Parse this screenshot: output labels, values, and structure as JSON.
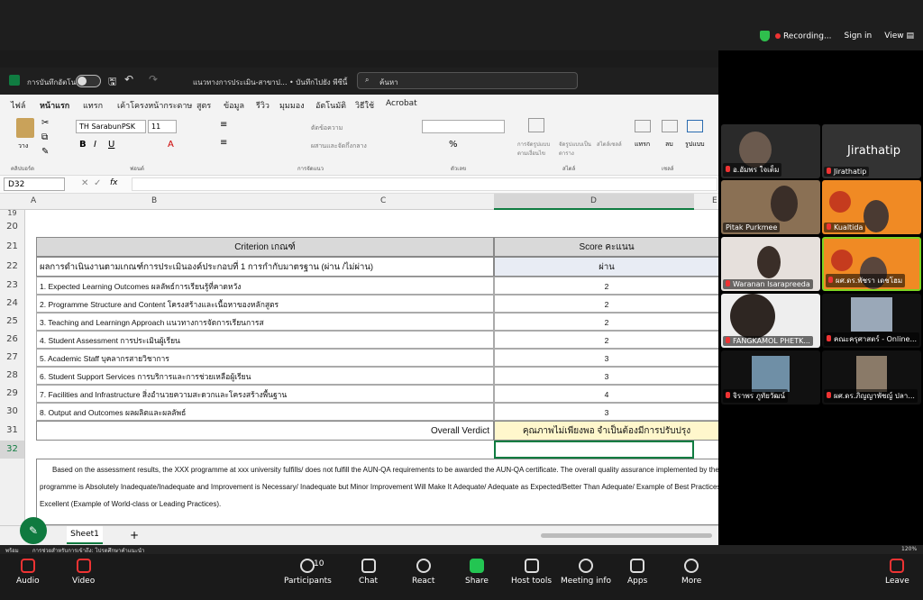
{
  "zoom_top": {
    "recording": "Recording...",
    "sign_in": "Sign in",
    "view": "View"
  },
  "excel": {
    "autosave": "การบันทึกอัตโนมัติ",
    "doc_title": "แนวทางการประเมิน-สาขาป... • บันทึกไปยัง พีซีนี้",
    "search": "ค้นหา",
    "menu": [
      "ไฟล์",
      "หน้าแรก",
      "แทรก",
      "เค้าโครงหน้ากระดาษ",
      "สูตร",
      "ข้อมูล",
      "รีวิว",
      "มุมมอง",
      "อัตโนมัติ",
      "วิธีใช้",
      "Acrobat"
    ],
    "font": "TH SarabunPSK",
    "font_size": "11",
    "groups": [
      "คลิปบอร์ด",
      "ฟอนต์",
      "การจัดแนว",
      "ตัวเลข",
      "สไตล์",
      "เซลล์"
    ],
    "ribbon_labels": {
      "paste": "วาง",
      "wrap": "ตัดข้อความ",
      "merge": "ผสานและจัดกึ่งกลาง",
      "cond_fmt": "การจัดรูปแบบตามเงื่อนไข",
      "fmt_table": "จัดรูปแบบเป็นตาราง",
      "cell_styles": "สไตล์เซลล์",
      "insert": "แทรก",
      "delete": "ลบ",
      "format": "รูปแบบ"
    },
    "namebox": "D32",
    "fx": "fx",
    "columns": [
      "A",
      "B",
      "C",
      "D",
      "E"
    ],
    "rows": [
      "19",
      "20",
      "21",
      "22",
      "23",
      "24",
      "25",
      "26",
      "27",
      "28",
      "29",
      "30",
      "31",
      "32"
    ],
    "table_header": {
      "criterion": "Criterion เกณฑ์",
      "score": "Score คะแนน"
    },
    "row22": {
      "label": "ผลการดำเนินงานตามเกณฑ์การประเมินองค์ประกอบที่ 1 การกำกับมาตรฐาน (ผ่าน /ไม่ผ่าน)",
      "score": "ผ่าน"
    },
    "criteria": [
      {
        "label": "1. Expected Learning Outcomes ผลลัพธ์การเรียนรู้ที่คาดหวัง",
        "score": "2"
      },
      {
        "label": "2. Programme Structure and Content โครงสร้างและเนื้อหาของหลักสูตร",
        "score": "2"
      },
      {
        "label": "3. Teaching and Learningn Approach แนวทางการจัดการเรียนการส",
        "score": "2"
      },
      {
        "label": "4. Student Assessment การประเมินผู้เรียน",
        "score": "2"
      },
      {
        "label": "5. Academic Staff บุคลากรสายวิชาการ",
        "score": "3"
      },
      {
        "label": "6. Student Support Services การบริการและการช่วยเหลือผู้เรียน",
        "score": "3"
      },
      {
        "label": "7. Facilities and Infrastructure สิ่งอำนวยความสะดวกและโครงสร้างพื้นฐาน",
        "score": "4"
      },
      {
        "label": "8. Output and Outcomes ผลผลิตและผลลัพธ์",
        "score": "3"
      }
    ],
    "overall_label": "Overall Verdict",
    "overall_value": "คุณภาพไม่เพียงพอ จำเป็นต้องมีการปรับปรุง",
    "paragraph": "Based on the assessment results, the XXX programme at xxx university fulfills/ does not fulfill the AUN-QA requirements to be awarded the AUN-QA certificate. The overall quality assurance implemented by the programme is Absolutely Inadequate/Inadequate and Improvement is Necessary/ Inadequate but Minor Improvement Will Make It Adequate/ Adequate as Expected/Better Than Adequate/ Example of Best Practices/ Excellent (Example of World-class or Leading Practices).",
    "sheet_tab": "Sheet1",
    "add_sheet": "+",
    "status_left": "พร้อม",
    "status_access": "การช่วยสำหรับการเข้าถึง: โปรดศึกษาคำแนะนำ",
    "zoom_level": "120%"
  },
  "participants": [
    {
      "name": "อ.อัมพร ใจเต็ม"
    },
    {
      "name": "Jirathatip",
      "big": "Jirathatip"
    },
    {
      "name": "Pitak Purkmee"
    },
    {
      "name": "Kualtida"
    },
    {
      "name": "Waranan Isarapreeda"
    },
    {
      "name": "ผศ.ดร.พัชรา เดชโฮม"
    },
    {
      "name": "FANGKAMOL PHETK..."
    },
    {
      "name": "คณะครุศาสตร์ - Online..."
    },
    {
      "name": "จิราพร ภูทัยวัฒน์"
    },
    {
      "name": "ผศ.ดร.ภิญญาพัชญ์ ปลา..."
    }
  ],
  "toolbar": {
    "audio": "Audio",
    "video": "Video",
    "participants": "Participants",
    "participants_count": "10",
    "chat": "Chat",
    "react": "React",
    "share": "Share",
    "host_tools": "Host tools",
    "meeting_info": "Meeting info",
    "apps": "Apps",
    "more": "More",
    "leave": "Leave"
  },
  "colors": {
    "accent": "#107c41",
    "recording": "#e33333",
    "share_green": "#23c552",
    "tile_orange": "#f08a24"
  }
}
